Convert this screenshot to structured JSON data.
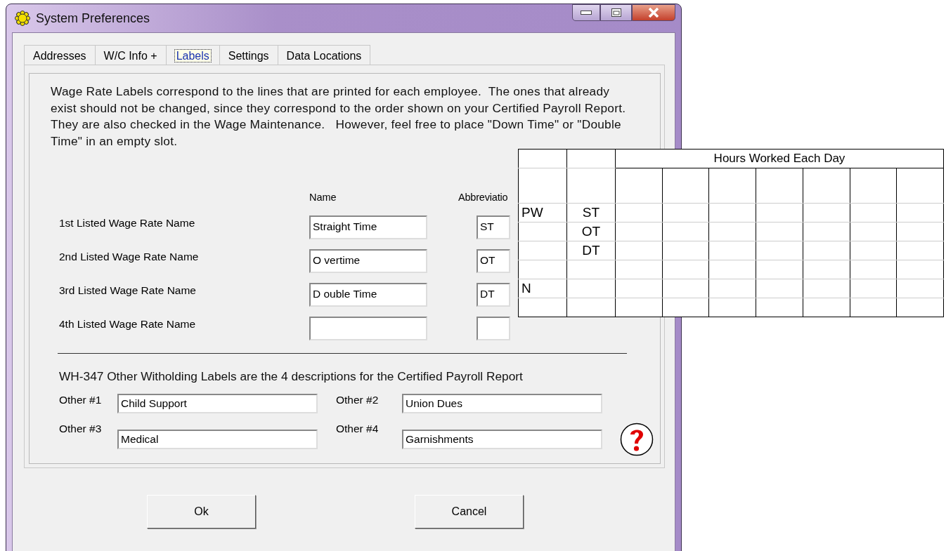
{
  "window": {
    "title": "System Preferences"
  },
  "tabs": [
    {
      "label": "Addresses",
      "selected": false
    },
    {
      "label": "W/C Info +",
      "selected": false
    },
    {
      "label": "Labels",
      "selected": true
    },
    {
      "label": "Settings",
      "selected": false
    },
    {
      "label": "Data Locations",
      "selected": false
    }
  ],
  "intro": "Wage Rate Labels correspond to the lines that are printed for each employee.  The ones that already exist should not be changed, since they correspond to the order shown on your Certified Payroll Report.  They are also checked in the Wage Maintenance.   However, feel free to place \"Down Time\" or \"Double Time\" in an empty slot.",
  "wage_rates": {
    "columns": [
      "Name",
      "Abbreviatio"
    ],
    "rows": [
      {
        "label": "1st Listed Wage Rate Name",
        "name": "Straight Time",
        "abbreviation": "ST"
      },
      {
        "label": "2nd Listed Wage Rate Name",
        "name": "O vertime",
        "abbreviation": "OT"
      },
      {
        "label": "3rd Listed Wage Rate Name",
        "name": "D ouble Time",
        "abbreviation": "DT"
      },
      {
        "label": "4th Listed Wage Rate Name"
      }
    ]
  },
  "withholding": {
    "heading": "WH-347 Other Witholding Labels are the 4 descriptions for the Certified Payroll Report",
    "fields": [
      {
        "label": "Other #1",
        "value": "Child Support"
      },
      {
        "label": "Other #2",
        "value": "Union Dues"
      },
      {
        "label": "Other #3",
        "value": "Medical"
      },
      {
        "label": "Other #4",
        "value": "Garnishments"
      }
    ]
  },
  "buttons": [
    {
      "label": "Ok"
    },
    {
      "label": "Cancel"
    }
  ],
  "sheet": {
    "header": "Hours Worked Each Day",
    "groups": [
      {
        "code": "PW",
        "rates": [
          "ST",
          "OT",
          "DT"
        ]
      },
      {
        "code": "N"
      }
    ]
  }
}
